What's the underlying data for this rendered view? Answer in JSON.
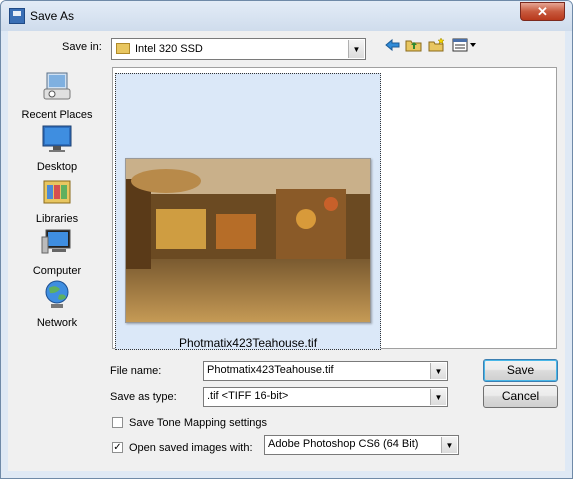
{
  "window": {
    "title": "Save As",
    "close_glyph": "✕"
  },
  "toolbar": {
    "save_in_label": "Save in:",
    "location": "Intel 320 SSD",
    "icons": [
      "back-icon",
      "up-folder-icon",
      "new-folder-icon",
      "views-menu-icon"
    ]
  },
  "sidebar": {
    "items": [
      {
        "label": "Recent Places",
        "icon": "recent-places-icon"
      },
      {
        "label": "Desktop",
        "icon": "desktop-icon"
      },
      {
        "label": "Libraries",
        "icon": "libraries-icon"
      },
      {
        "label": "Computer",
        "icon": "computer-icon"
      },
      {
        "label": "Network",
        "icon": "network-icon"
      }
    ]
  },
  "files": [
    {
      "name": "Photmatix423Teahouse.tif",
      "selected": true
    }
  ],
  "form": {
    "file_name_label": "File name:",
    "file_name_value": "Photmatix423Teahouse.tif",
    "save_as_type_label": "Save as type:",
    "save_as_type_value": ".tif <TIFF 16-bit>",
    "save_tone_mapping_label": "Save Tone Mapping settings",
    "save_tone_mapping_checked": false,
    "open_saved_label": "Open saved images with:",
    "open_saved_checked": true,
    "open_with_value": "Adobe Photoshop CS6 (64 Bit)"
  },
  "buttons": {
    "save": "Save",
    "cancel": "Cancel"
  },
  "colors": {
    "selection": "#dbe8f8",
    "title_bar": "#dfe9f5",
    "close_button": "#c85a3e"
  }
}
